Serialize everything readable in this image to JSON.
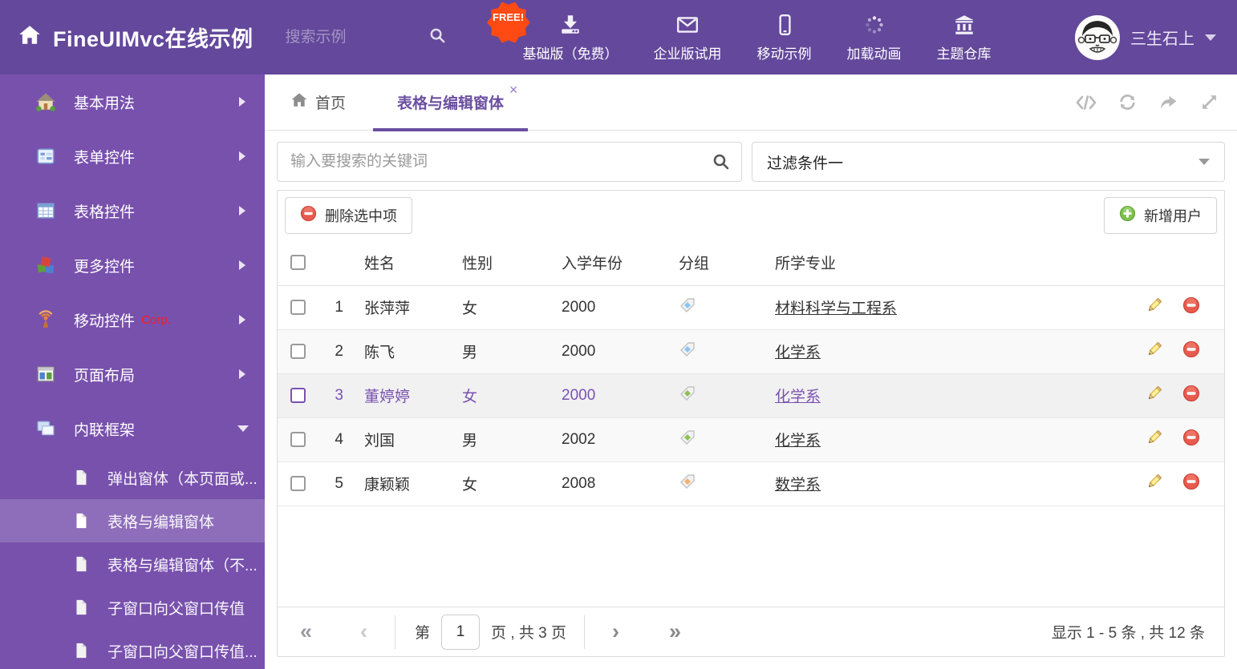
{
  "colors": {
    "header_bg": "#63489b",
    "sidebar_bg": "#7851ad",
    "accent": "#6b4fa0",
    "selected_text": "#7a52b0",
    "free_badge": "#ff4a14",
    "delete_red": "#e85a4d",
    "add_green": "#7fbf4d",
    "tag_blue": "#86c6f4",
    "tag_green": "#8cc152",
    "tag_orange": "#f5b06a"
  },
  "header": {
    "title": "FineUIMvc在线示例",
    "search_placeholder": "搜索示例",
    "free_badge": "FREE!",
    "nav": [
      {
        "label": "基础版（免费）",
        "icon": "download-icon"
      },
      {
        "label": "企业版试用",
        "icon": "envelope-icon"
      },
      {
        "label": "移动示例",
        "icon": "mobile-icon"
      },
      {
        "label": "加载动画",
        "icon": "spinner-icon"
      },
      {
        "label": "主题仓库",
        "icon": "bank-icon"
      }
    ],
    "user_name": "三生石上"
  },
  "sidebar": {
    "items": [
      {
        "label": "基本用法",
        "icon": "home-icon"
      },
      {
        "label": "表单控件",
        "icon": "form-icon"
      },
      {
        "label": "表格控件",
        "icon": "table-icon"
      },
      {
        "label": "更多控件",
        "icon": "cubes-icon"
      },
      {
        "label": "移动控件",
        "tag": "Corp.",
        "icon": "antenna-icon"
      },
      {
        "label": "页面布局",
        "icon": "layout-icon"
      },
      {
        "label": "内联框架",
        "icon": "frames-icon",
        "expanded": "true"
      }
    ],
    "subitems": [
      {
        "label": "弹出窗体（本页面或..."
      },
      {
        "label": "表格与编辑窗体",
        "selected": "true"
      },
      {
        "label": "表格与编辑窗体（不..."
      },
      {
        "label": "子窗口向父窗口传值"
      },
      {
        "label": "子窗口向父窗口传值..."
      }
    ]
  },
  "tabs": {
    "home": "首页",
    "active": "表格与编辑窗体",
    "close": "✕"
  },
  "filterbar": {
    "search_placeholder": "输入要搜索的关键词",
    "filter_value": "过滤条件一"
  },
  "toolbar": {
    "delete_label": "删除选中项",
    "add_label": "新增用户"
  },
  "table": {
    "columns": [
      "姓名",
      "性别",
      "入学年份",
      "分组",
      "所学专业"
    ],
    "rows": [
      {
        "num": "1",
        "name": "张萍萍",
        "gender": "女",
        "year": "2000",
        "tag": "blue",
        "major": "材料科学与工程系"
      },
      {
        "num": "2",
        "name": "陈飞",
        "gender": "男",
        "year": "2000",
        "tag": "blue",
        "major": "化学系"
      },
      {
        "num": "3",
        "name": "董婷婷",
        "gender": "女",
        "year": "2000",
        "tag": "green",
        "major": "化学系",
        "selected": "true"
      },
      {
        "num": "4",
        "name": "刘国",
        "gender": "男",
        "year": "2002",
        "tag": "green",
        "major": "化学系"
      },
      {
        "num": "5",
        "name": "康颖颖",
        "gender": "女",
        "year": "2008",
        "tag": "orange",
        "major": "数学系"
      }
    ]
  },
  "pagination": {
    "label_page": "第",
    "page_value": "1",
    "label_total": "页 , 共 3 页",
    "summary": "显示 1 - 5 条 , 共 12 条",
    "icons": {
      "first": "«",
      "prev": "‹",
      "next": "›",
      "last": "»"
    }
  }
}
